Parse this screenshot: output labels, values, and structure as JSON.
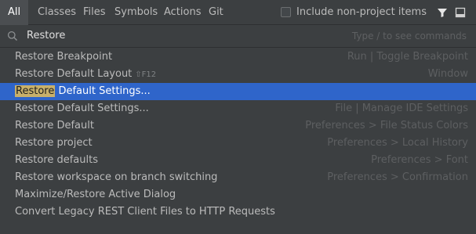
{
  "tabs": [
    {
      "label": "All"
    },
    {
      "label": "Classes"
    },
    {
      "label": "Files"
    },
    {
      "label": "Symbols"
    },
    {
      "label": "Actions"
    },
    {
      "label": "Git"
    }
  ],
  "include_label": "Include non-project items",
  "include_checked": false,
  "search": {
    "value": "Restore",
    "hint": "Type / to see commands"
  },
  "colors": {
    "selection": "#2f65ca",
    "match_highlight": "#c8b06a"
  },
  "results": [
    {
      "name": "Restore Breakpoint",
      "shortcut": "",
      "path": "Run | Toggle Breakpoint"
    },
    {
      "name": "Restore Default Layout",
      "shortcut": "⇧F12",
      "path": "Window"
    },
    {
      "name_match": "Restore",
      "name_rest": " Default Settings...",
      "shortcut": "",
      "path": "",
      "selected": true
    },
    {
      "name": "Restore Default Settings...",
      "shortcut": "",
      "path": "File | Manage IDE Settings"
    },
    {
      "name": "Restore Default",
      "shortcut": "",
      "path": "Preferences > File Status Colors"
    },
    {
      "name": "Restore project",
      "shortcut": "",
      "path": "Preferences > Local History"
    },
    {
      "name": "Restore defaults",
      "shortcut": "",
      "path": "Preferences > Font"
    },
    {
      "name": "Restore workspace on branch switching",
      "shortcut": "",
      "path": "Preferences > Confirmation"
    },
    {
      "name": "Maximize/Restore Active Dialog",
      "shortcut": "",
      "path": ""
    },
    {
      "name": "Convert Legacy REST Client Files to HTTP Requests",
      "shortcut": "",
      "path": ""
    }
  ]
}
